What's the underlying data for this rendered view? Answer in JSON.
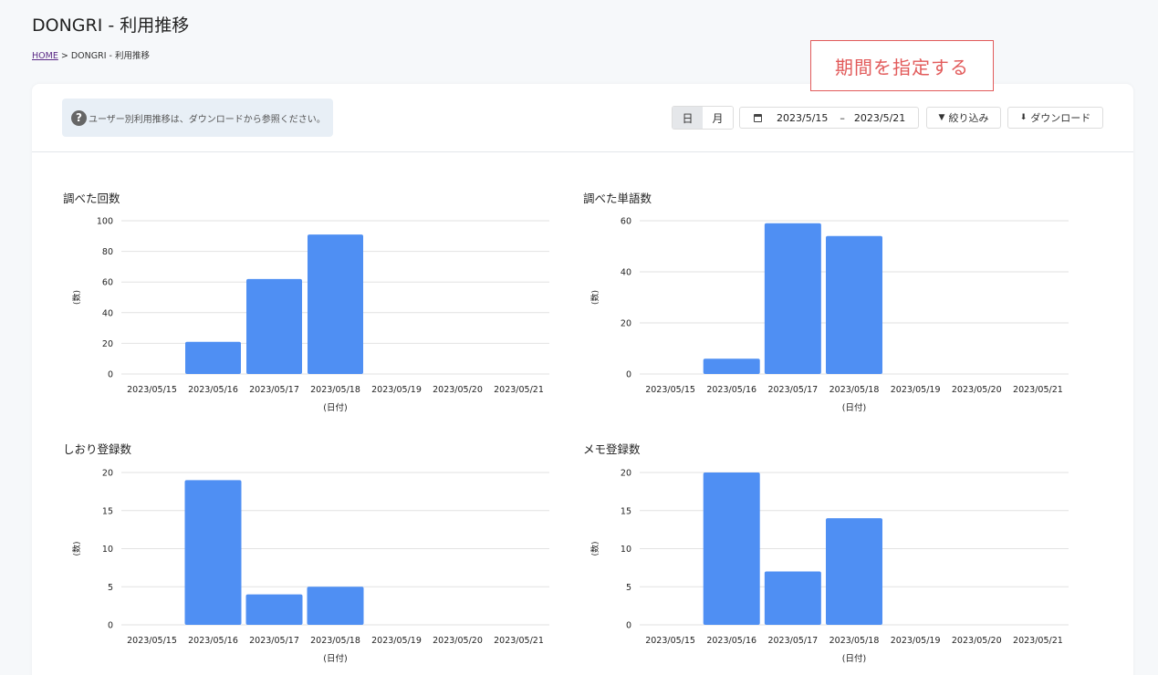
{
  "header": {
    "title": "DONGRI - 利用推移",
    "breadcrumb_home": "HOME",
    "breadcrumb_sep": ">",
    "breadcrumb_current": "DONGRI - 利用推移"
  },
  "toolbar": {
    "info_text": "ユーザー別利用推移は、ダウンロードから参照ください。",
    "toggle_day": "日",
    "toggle_month": "月",
    "date_start": "2023/5/15",
    "date_sep": "–",
    "date_end": "2023/5/21",
    "filter_label": "絞り込み",
    "download_label": "ダウンロード"
  },
  "callout": {
    "text": "期間を指定する"
  },
  "colors": {
    "bar": "#4f8ff3",
    "grid": "#e2e2e2",
    "callout": "#e25b5b"
  },
  "chart_data": [
    {
      "type": "bar",
      "title": "調べた回数",
      "ylabel": "(数)",
      "xlabel": "(日付)",
      "categories": [
        "2023/05/15",
        "2023/05/16",
        "2023/05/17",
        "2023/05/18",
        "2023/05/19",
        "2023/05/20",
        "2023/05/21"
      ],
      "values": [
        0,
        21,
        62,
        91,
        0,
        0,
        0
      ],
      "ylim": [
        0,
        100
      ],
      "yticks": [
        0,
        20,
        40,
        60,
        80,
        100
      ]
    },
    {
      "type": "bar",
      "title": "調べた単語数",
      "ylabel": "(数)",
      "xlabel": "(日付)",
      "categories": [
        "2023/05/15",
        "2023/05/16",
        "2023/05/17",
        "2023/05/18",
        "2023/05/19",
        "2023/05/20",
        "2023/05/21"
      ],
      "values": [
        0,
        6,
        59,
        54,
        0,
        0,
        0
      ],
      "ylim": [
        0,
        60
      ],
      "yticks": [
        0,
        20,
        40,
        60
      ]
    },
    {
      "type": "bar",
      "title": "しおり登録数",
      "ylabel": "(数)",
      "xlabel": "(日付)",
      "categories": [
        "2023/05/15",
        "2023/05/16",
        "2023/05/17",
        "2023/05/18",
        "2023/05/19",
        "2023/05/20",
        "2023/05/21"
      ],
      "values": [
        0,
        19,
        4,
        5,
        0,
        0,
        0
      ],
      "ylim": [
        0,
        20
      ],
      "yticks": [
        0,
        5,
        10,
        15,
        20
      ]
    },
    {
      "type": "bar",
      "title": "メモ登録数",
      "ylabel": "(数)",
      "xlabel": "(日付)",
      "categories": [
        "2023/05/15",
        "2023/05/16",
        "2023/05/17",
        "2023/05/18",
        "2023/05/19",
        "2023/05/20",
        "2023/05/21"
      ],
      "values": [
        0,
        20,
        7,
        14,
        0,
        0,
        0
      ],
      "ylim": [
        0,
        20
      ],
      "yticks": [
        0,
        5,
        10,
        15,
        20
      ]
    }
  ]
}
